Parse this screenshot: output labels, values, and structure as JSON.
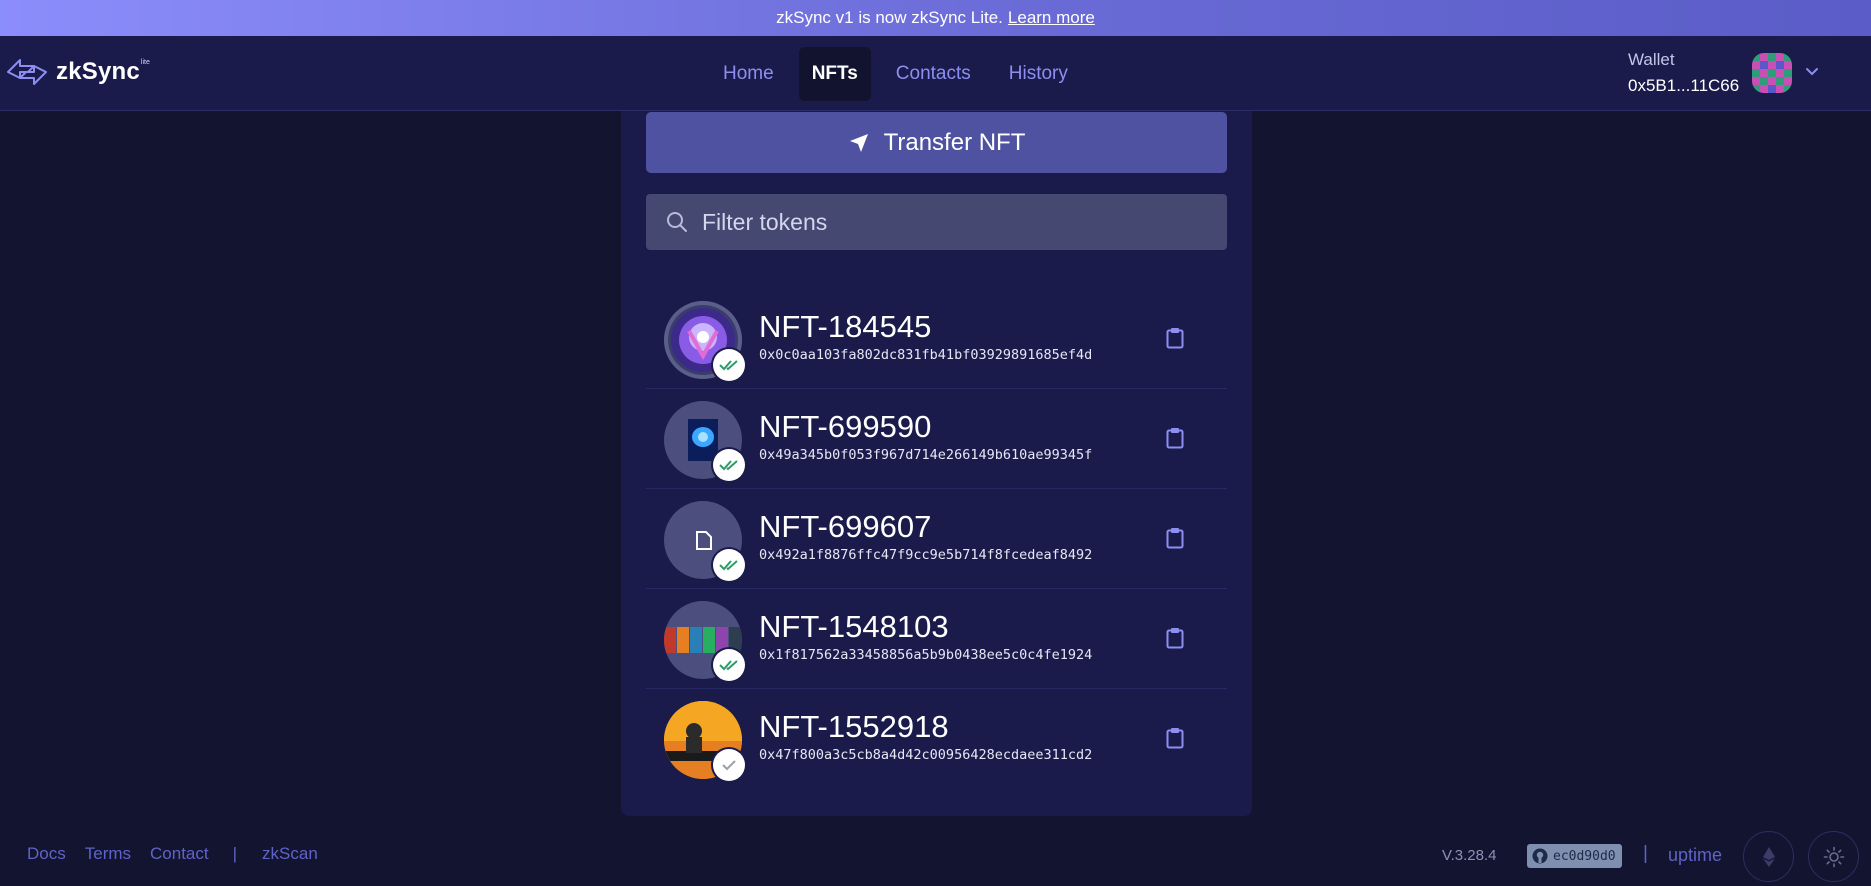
{
  "banner": {
    "text": "zkSync v1 is now zkSync Lite.",
    "link": "Learn more"
  },
  "header": {
    "logo_text": "zkSync",
    "logo_badge": "lite",
    "nav": [
      {
        "label": "Home"
      },
      {
        "label": "NFTs",
        "active": true
      },
      {
        "label": "Contacts"
      },
      {
        "label": "History"
      }
    ],
    "wallet_label": "Wallet",
    "wallet_address": "0x5B1...11C66"
  },
  "main": {
    "transfer_label": "Transfer NFT",
    "filter_placeholder": "Filter tokens",
    "nfts": [
      {
        "name": "NFT-184545",
        "address": "0x0c0aa103fa802dc831fb41bf03929891685ef4d",
        "verified": "double-check"
      },
      {
        "name": "NFT-699590",
        "address": "0x49a345b0f053f967d714e266149b610ae99345f",
        "verified": "double-check"
      },
      {
        "name": "NFT-699607",
        "address": "0x492a1f8876ffc47f9cc9e5b714f8fcedeaf8492",
        "verified": "double-check"
      },
      {
        "name": "NFT-1548103",
        "address": "0x1f817562a33458856a5b9b0438ee5c0c4fe1924",
        "verified": "double-check"
      },
      {
        "name": "NFT-1552918",
        "address": "0x47f800a3c5cb8a4d42c00956428ecdaee311cd2",
        "verified": "single-check"
      }
    ]
  },
  "footer": {
    "links": [
      "Docs",
      "Terms",
      "Contact"
    ],
    "zkscan": "zkScan",
    "version": "V.3.28.4",
    "commit": "ec0d90d0",
    "uptime": "uptime",
    "separator": "|"
  },
  "colors": {
    "background": "#131530",
    "panel": "#1a1b4b",
    "accent": "#4f52a0",
    "link": "#5f62c6",
    "verified": "#2e9c6a"
  }
}
